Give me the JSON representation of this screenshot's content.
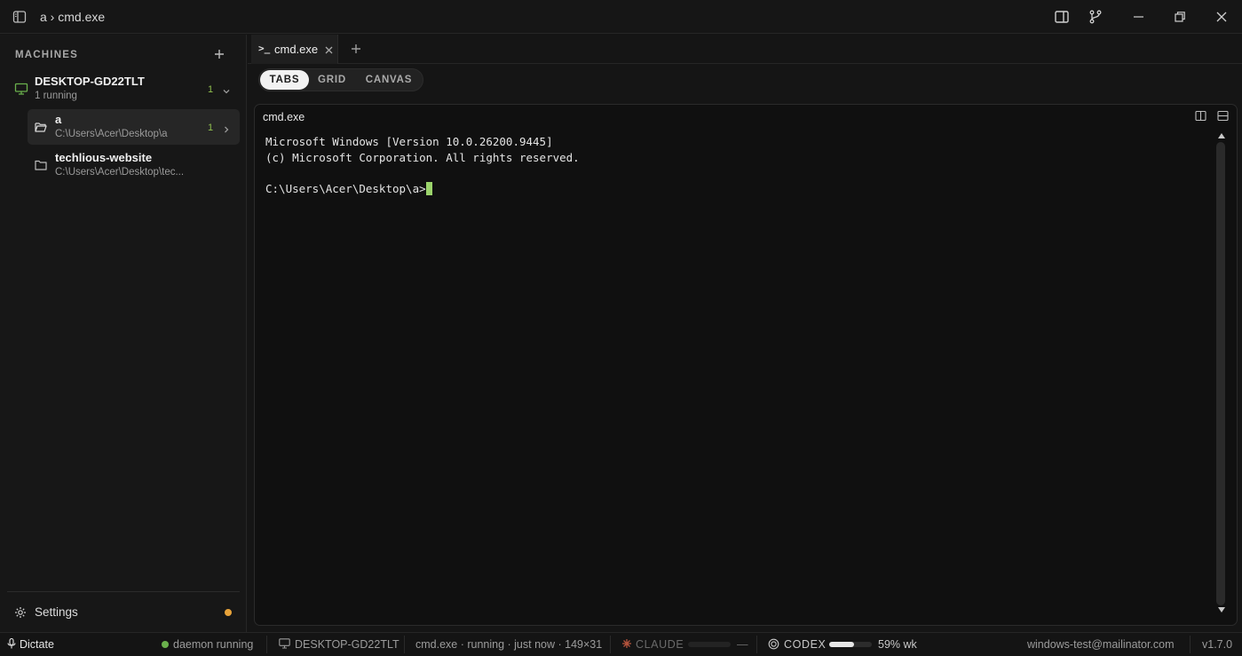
{
  "titlebar": {
    "breadcrumb": "a › cmd.exe",
    "icons": [
      "sidebar-toggle-icon",
      "split-panel-icon",
      "git-branch-icon",
      "minimize-icon",
      "restore-icon",
      "close-icon"
    ]
  },
  "sidebar": {
    "section_title": "MACHINES",
    "machine": {
      "name": "DESKTOP-GD22TLT",
      "status": "1 running",
      "count": "1"
    },
    "folders": [
      {
        "name": "a",
        "path": "C:\\Users\\Acer\\Desktop\\a",
        "count": "1",
        "active": true
      },
      {
        "name": "techlious-website",
        "path": "C:\\Users\\Acer\\Desktop\\tec...",
        "count": "",
        "active": false
      }
    ],
    "settings_label": "Settings",
    "settings_dot_color": "#e8a33a"
  },
  "tabs": [
    {
      "prompt": ">_",
      "label": "cmd.exe"
    }
  ],
  "view_modes": {
    "tabs": "TABS",
    "grid": "GRID",
    "canvas": "CANVAS",
    "selected": "TABS"
  },
  "panel": {
    "title": "cmd.exe",
    "terminal_lines": [
      "Microsoft Windows [Version 10.0.26200.9445]",
      "(c) Microsoft Corporation. All rights reserved.",
      "",
      "C:\\Users\\Acer\\Desktop\\a>"
    ],
    "cursor_color": "#9bd36b"
  },
  "statusbar": {
    "dictate": "Dictate",
    "daemon": "daemon running",
    "machine": "DESKTOP-GD22TLT",
    "session": "cmd.exe · running · just now · 149×31",
    "claude_label": "CLAUDE",
    "claude_value": "—",
    "codex_label": "CODEX",
    "codex_usage": "59% wk",
    "codex_usage_fraction": 0.59,
    "account": "windows-test@mailinator.com",
    "version": "v1.7.0",
    "accent_green": "#6ab04c"
  }
}
